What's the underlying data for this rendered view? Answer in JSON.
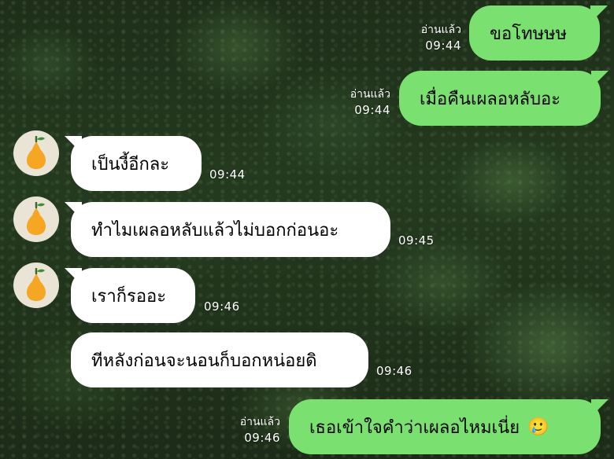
{
  "chat": {
    "read_label": "อ่านแล้ว",
    "messages": [
      {
        "side": "out",
        "text": "ขอโทษษษ",
        "time": "09:44",
        "read": "อ่านแล้ว"
      },
      {
        "side": "out",
        "text": "เมื่อคืนเผลอหลับอะ",
        "time": "09:44",
        "read": "อ่านแล้ว"
      },
      {
        "side": "in",
        "text": "เป็นงี้อีกละ",
        "time": "09:44"
      },
      {
        "side": "in",
        "text": "ทำไมเผลอหลับแล้วไม่บอกก่อนอะ",
        "time": "09:45"
      },
      {
        "side": "in",
        "text": "เราก็รออะ",
        "time": "09:46"
      },
      {
        "side": "in",
        "text": "ทีหลังก่อนจะนอนก็บอกหน่อยดิ",
        "time": "09:46"
      },
      {
        "side": "out",
        "text": "เธอเข้าใจคำว่าเผลอไหมเนี่ย",
        "time": "09:46",
        "read": "อ่านแล้ว",
        "emoji": "🥲"
      }
    ]
  },
  "avatar": {
    "icon": "pear-icon",
    "bg": "#e9e4d6",
    "fruit_color": "#f5a623"
  },
  "colors": {
    "out_bubble": "#7ae06f",
    "in_bubble": "#ffffff"
  }
}
